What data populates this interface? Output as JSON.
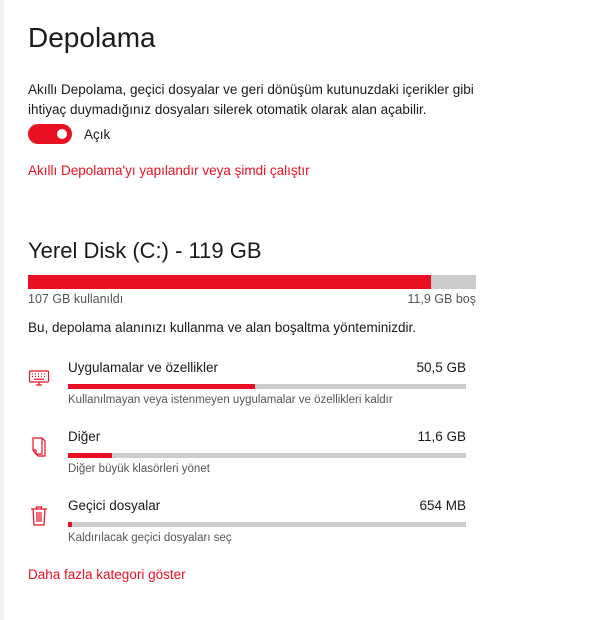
{
  "page": {
    "title": "Depolama"
  },
  "smart_storage": {
    "description": "Akıllı Depolama, geçici dosyalar ve geri dönüşüm kutunuzdaki içerikler gibi ihtiyaç duymadığınız dosyaları silerek otomatik olarak alan açabilir.",
    "toggle_state": "Açık",
    "toggle_on": true,
    "configure_link": "Akıllı Depolama'yı yapılandır veya şimdi çalıştır"
  },
  "disk": {
    "title": "Yerel Disk (C:) - 119 GB",
    "used_label": "107 GB kullanıldı",
    "free_label": "11,9 GB boş",
    "used_fraction": 0.9,
    "usage_note": "Bu, depolama alanınızı kullanma ve alan boşaltma yönteminizdir."
  },
  "categories": [
    {
      "icon": "keyboard-icon",
      "name": "Uygulamalar ve özellikler",
      "size": "50,5 GB",
      "fill_fraction": 0.47,
      "description": "Kullanılmayan veya istenmeyen uygulamalar ve özellikleri kaldır"
    },
    {
      "icon": "folder-icon",
      "name": "Diğer",
      "size": "11,6 GB",
      "fill_fraction": 0.11,
      "description": "Diğer büyük klasörleri yönet"
    },
    {
      "icon": "trash-icon",
      "name": "Geçici dosyalar",
      "size": "654 MB",
      "fill_fraction": 0.01,
      "description": "Kaldırılacak geçici dosyaları seç"
    }
  ],
  "more_link": "Daha fazla kategori göster",
  "colors": {
    "accent": "#e81123",
    "bar_track": "#cccccc"
  }
}
